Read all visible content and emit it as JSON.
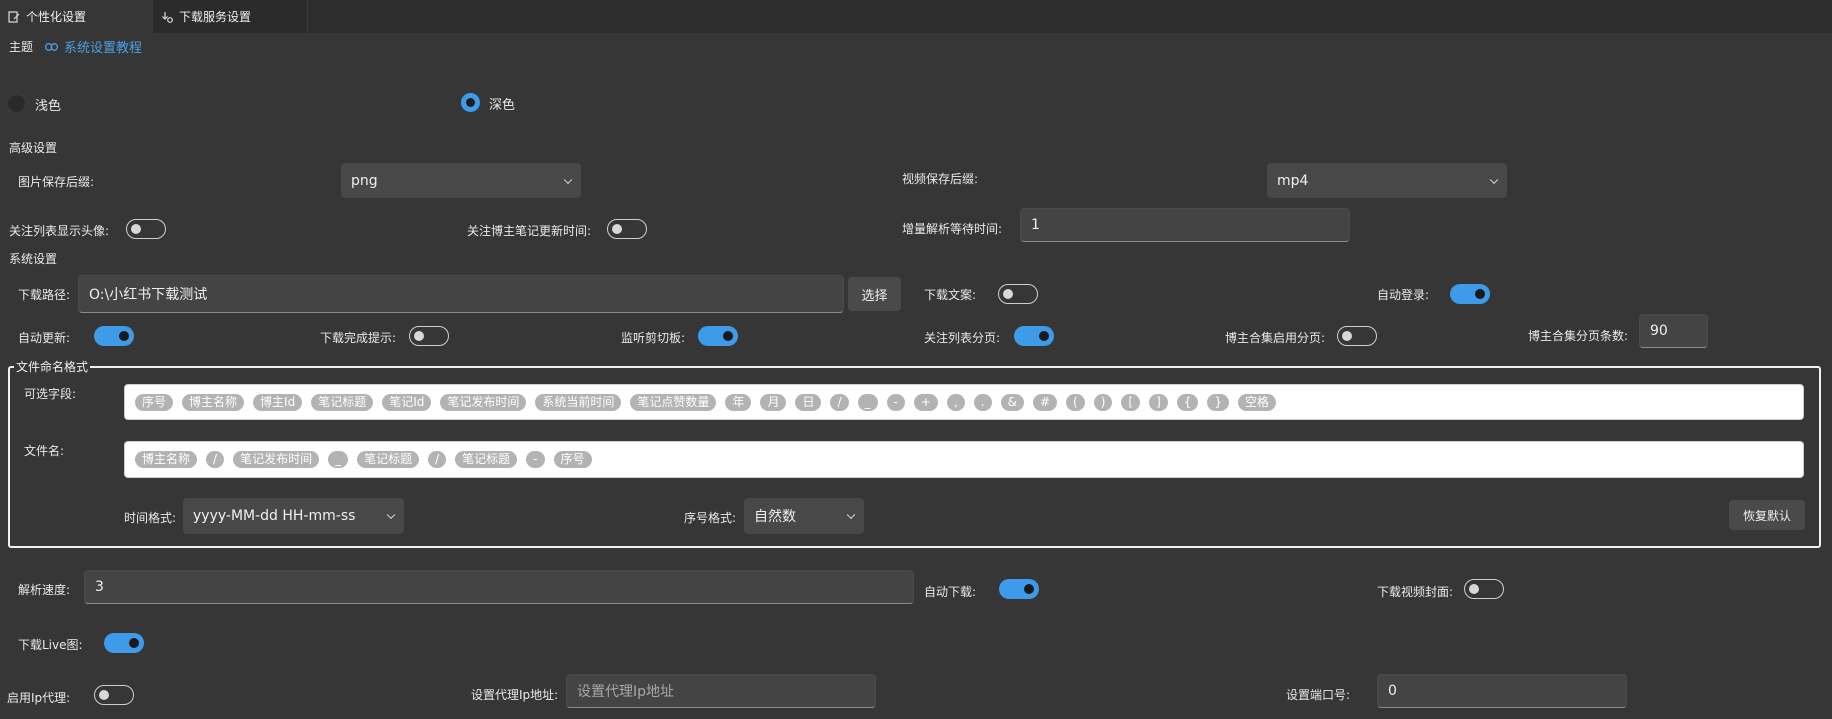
{
  "tabs": [
    {
      "label": "个性化设置",
      "icon": "edit-doc-icon"
    },
    {
      "label": "下载服务设置",
      "icon": "download-settings-icon"
    }
  ],
  "theme": {
    "label": "主题",
    "tutorial_link": "系统设置教程",
    "light_label": "浅色",
    "dark_label": "深色",
    "selected": "深色"
  },
  "advanced": {
    "section_label": "高级设置",
    "image_suffix_label": "图片保存后缀:",
    "image_suffix_value": "png",
    "video_suffix_label": "视频保存后缀:",
    "video_suffix_value": "mp4",
    "show_avatar_label": "关注列表显示头像:",
    "show_avatar": false,
    "update_time_label": "关注博主笔记更新时间:",
    "update_time": false,
    "incremental_wait_label": "增量解析等待时间:",
    "incremental_wait_value": "1"
  },
  "system": {
    "section_label": "系统设置",
    "download_path_label": "下载路径:",
    "download_path_value": "O:\\小红书下载测试",
    "choose_button": "选择",
    "download_copy_label": "下载文案:",
    "download_copy": false,
    "auto_login_label": "自动登录:",
    "auto_login": true,
    "auto_update_label": "自动更新:",
    "auto_update": true,
    "download_complete_label": "下载完成提示:",
    "download_complete": false,
    "clipboard_label": "监听剪切板:",
    "clipboard": true,
    "follow_paging_label": "关注列表分页:",
    "follow_paging": true,
    "collection_paging_label": "博主合集启用分页:",
    "collection_paging": false,
    "page_size_label": "博主合集分页条数:",
    "page_size_value": "90"
  },
  "filename": {
    "group_title": "文件命名格式",
    "optional_label": "可选字段:",
    "optional_fields": [
      "序号",
      "博主名称",
      "博主Id",
      "笔记标题",
      "笔记Id",
      "笔记发布时间",
      "系统当前时间",
      "笔记点赞数量",
      "年",
      "月",
      "日",
      "/",
      "_",
      "-",
      "+",
      ",",
      ".",
      "&",
      "#",
      "(",
      ")",
      "[",
      "]",
      "{",
      "}",
      "空格"
    ],
    "name_label": "文件名:",
    "name_fields": [
      "博主名称",
      "/",
      "笔记发布时间",
      "_",
      "笔记标题",
      "/",
      "笔记标题",
      "-",
      "序号"
    ],
    "time_format_label": "时间格式:",
    "time_format_value": "yyyy-MM-dd HH-mm-ss",
    "seq_format_label": "序号格式:",
    "seq_format_value": "自然数",
    "reset_button": "恢复默认"
  },
  "misc": {
    "parse_speed_label": "解析速度:",
    "parse_speed_value": "3",
    "auto_download_label": "自动下载:",
    "auto_download": true,
    "download_cover_label": "下载视频封面:",
    "download_cover": false,
    "download_live_label": "下载Live图:",
    "download_live": true,
    "enable_proxy_label": "启用Ip代理:",
    "enable_proxy": false,
    "proxy_address_label": "设置代理Ip地址:",
    "proxy_address_placeholder": "设置代理Ip地址",
    "port_label": "设置端口号:",
    "port_value": "0"
  },
  "colors": {
    "background": "#363636",
    "accent": "#3d9be9",
    "link": "#4aa0e6"
  }
}
